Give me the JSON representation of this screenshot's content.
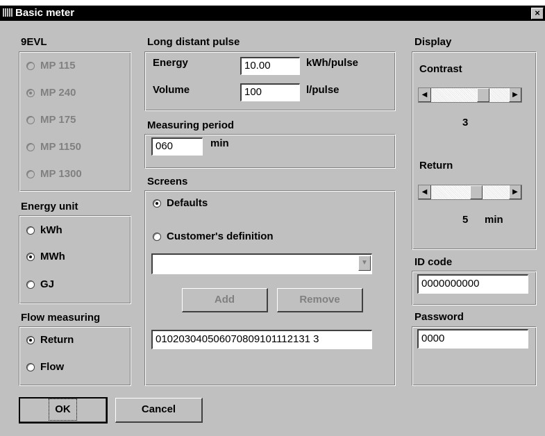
{
  "window": {
    "title": "Basic meter",
    "close_icon": "×"
  },
  "meter_group": {
    "title": "9EVL",
    "options": [
      "MP 115",
      "MP 240",
      "MP 175",
      "MP 1150",
      "MP 1300"
    ],
    "selected": "MP 240"
  },
  "energy_unit": {
    "title": "Energy unit",
    "options": [
      "kWh",
      "MWh",
      "GJ"
    ],
    "selected": "MWh"
  },
  "flow_measuring": {
    "title": "Flow measuring",
    "options": [
      "Return",
      "Flow"
    ],
    "selected": "Return"
  },
  "long_distant_pulse": {
    "title": "Long distant pulse",
    "energy_label": "Energy",
    "energy_value": "10.00",
    "energy_unit": "kWh/pulse",
    "volume_label": "Volume",
    "volume_value": "100",
    "volume_unit": "l/pulse"
  },
  "measuring_period": {
    "title": "Measuring period",
    "value": "060",
    "unit": "min"
  },
  "screens": {
    "title": "Screens",
    "defaults_label": "Defaults",
    "custom_label": "Customer's definition",
    "selected": "Defaults",
    "combo_value": "",
    "add_label": "Add",
    "remove_label": "Remove",
    "sequence_value": "010203040506070809101112131 3"
  },
  "display": {
    "title": "Display",
    "contrast_label": "Contrast",
    "contrast_value": "3",
    "return_label": "Return",
    "return_value": "5",
    "return_unit": "min"
  },
  "id_code": {
    "title": "ID code",
    "value": "0000000000"
  },
  "password": {
    "title": "Password",
    "value": "0000"
  },
  "buttons": {
    "ok": "OK",
    "cancel": "Cancel"
  },
  "icons": {
    "left_arrow": "◀",
    "right_arrow": "▶",
    "down_arrow": "▼"
  }
}
